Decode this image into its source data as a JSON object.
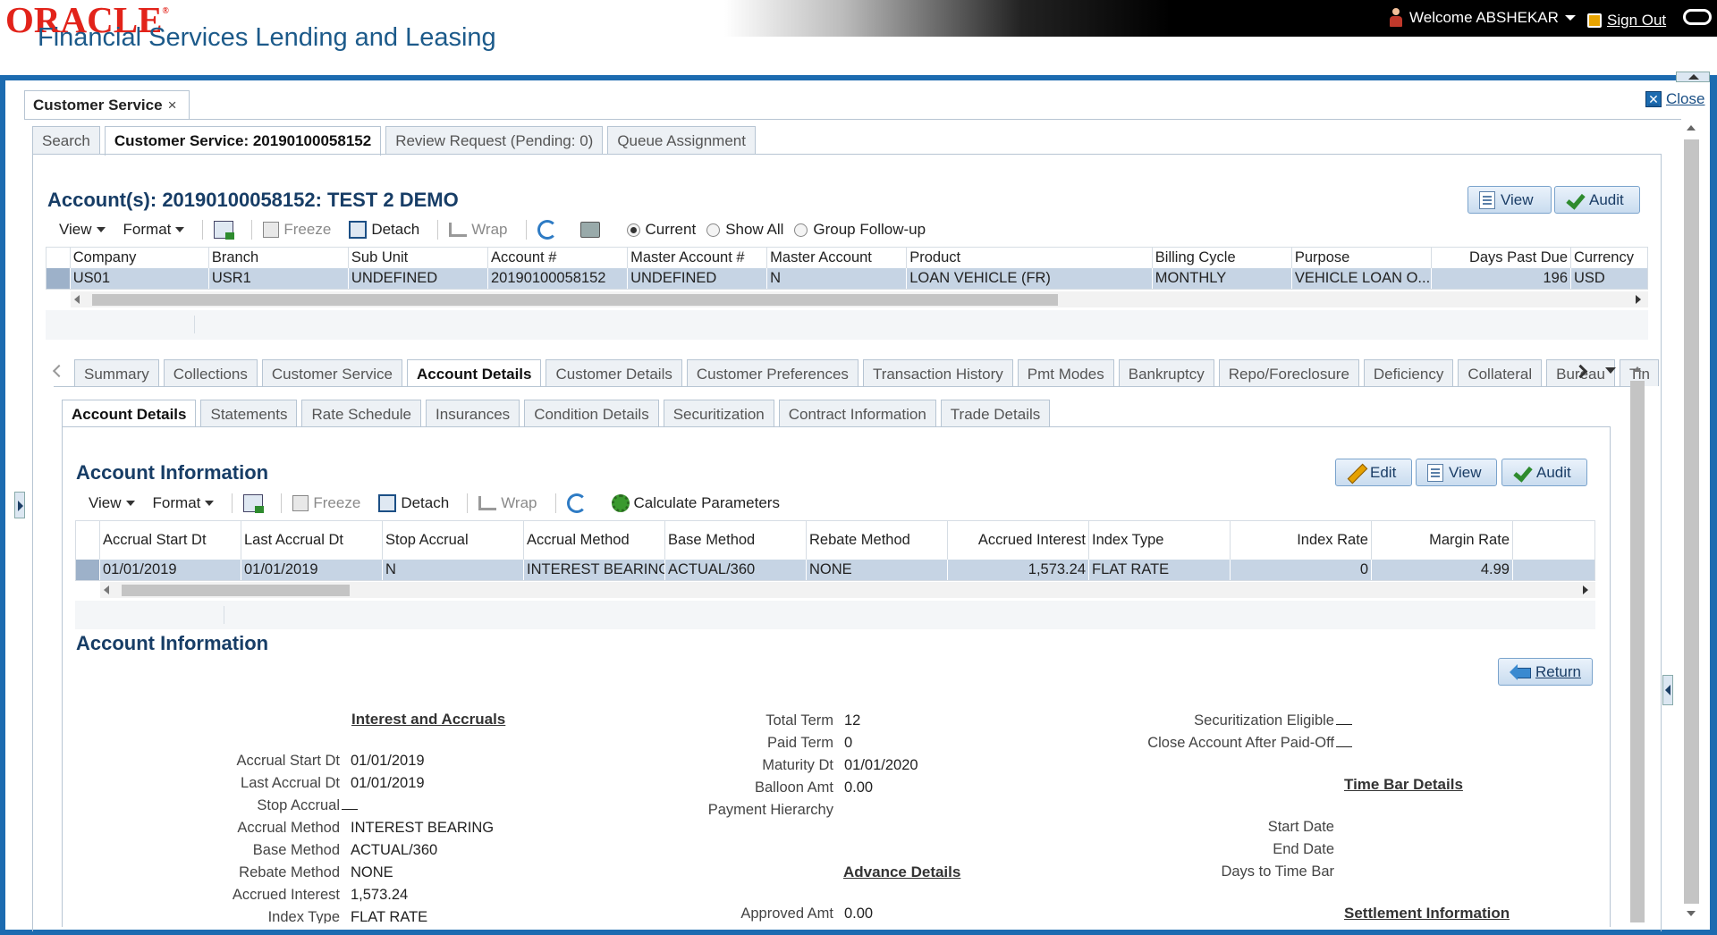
{
  "header": {
    "brand": "ORACLE",
    "product": "Financial Services Lending and Leasing",
    "welcome": "Welcome ABSHEKAR",
    "signout": "Sign Out"
  },
  "window": {
    "tab_title": "Customer Service",
    "close_label": "Close"
  },
  "top_tabs": [
    "Search",
    "Customer Service: 20190100058152",
    "Review Request (Pending: 0)",
    "Queue Assignment"
  ],
  "accounts": {
    "title": "Account(s): 20190100058152: TEST 2 DEMO",
    "buttons": {
      "view": "View",
      "audit": "Audit"
    },
    "toolbar": {
      "view": "View",
      "format": "Format",
      "freeze": "Freeze",
      "detach": "Detach",
      "wrap": "Wrap"
    },
    "radios": {
      "current": "Current",
      "show_all": "Show All",
      "group_follow_up": "Group Follow-up",
      "selected": "current"
    },
    "columns": [
      "Company",
      "Branch",
      "Sub Unit",
      "Account #",
      "Master Account #",
      "Master Account",
      "Product",
      "Billing Cycle",
      "Purpose",
      "Days Past Due",
      "Currency"
    ],
    "row": [
      "US01",
      "USR1",
      "UNDEFINED",
      "20190100058152",
      "UNDEFINED",
      "N",
      "LOAN VEHICLE (FR)",
      "MONTHLY",
      "VEHICLE LOAN O...",
      "196",
      "USD"
    ]
  },
  "section_tabs": [
    "Summary",
    "Collections",
    "Customer Service",
    "Account Details",
    "Customer Details",
    "Customer Preferences",
    "Transaction History",
    "Pmt Modes",
    "Bankruptcy",
    "Repo/Foreclosure",
    "Deficiency",
    "Collateral",
    "Bureau",
    "Tin"
  ],
  "detail_tabs": [
    "Account Details",
    "Statements",
    "Rate Schedule",
    "Insurances",
    "Condition Details",
    "Securitization",
    "Contract Information",
    "Trade Details"
  ],
  "account_info": {
    "title": "Account Information",
    "buttons": {
      "edit": "Edit",
      "view": "View",
      "audit": "Audit"
    },
    "toolbar": {
      "view": "View",
      "format": "Format",
      "freeze": "Freeze",
      "detach": "Detach",
      "wrap": "Wrap",
      "calculate": "Calculate Parameters"
    },
    "columns": [
      "Accrual Start Dt",
      "Last Accrual Dt",
      "Stop Accrual",
      "Accrual Method",
      "Base Method",
      "Rebate Method",
      "Accrued Interest",
      "Index Type",
      "Index Rate",
      "Margin Rate"
    ],
    "row": [
      "01/01/2019",
      "01/01/2019",
      "N",
      "INTEREST BEARING",
      "ACTUAL/360",
      "NONE",
      "1,573.24",
      "FLAT RATE",
      "0",
      "4.99"
    ]
  },
  "detail": {
    "title": "Account Information",
    "return_label": "Return",
    "interest_heading": "Interest and Accruals",
    "interest": [
      {
        "label": "Accrual Start Dt",
        "value": "01/01/2019"
      },
      {
        "label": "Last Accrual Dt",
        "value": "01/01/2019"
      },
      {
        "label": "Stop Accrual",
        "value": ""
      },
      {
        "label": "Accrual Method",
        "value": "INTEREST BEARING"
      },
      {
        "label": "Base Method",
        "value": "ACTUAL/360"
      },
      {
        "label": "Rebate Method",
        "value": "NONE"
      },
      {
        "label": "Accrued Interest",
        "value": "1,573.24"
      },
      {
        "label": "Index Type",
        "value": "FLAT RATE"
      }
    ],
    "term": [
      {
        "label": "Total Term",
        "value": "12"
      },
      {
        "label": "Paid Term",
        "value": "0"
      },
      {
        "label": "Maturity Dt",
        "value": "01/01/2020"
      },
      {
        "label": "Balloon Amt",
        "value": "0.00"
      },
      {
        "label": "Payment Hierarchy",
        "value": ""
      }
    ],
    "advance_heading": "Advance Details",
    "advance": [
      {
        "label": "Approved Amt",
        "value": "0.00"
      }
    ],
    "securitization": [
      {
        "label": "Securitization Eligible",
        "value": ""
      },
      {
        "label": "Close Account After Paid-Off",
        "value": ""
      }
    ],
    "timebar_heading": "Time Bar Details",
    "timebar": [
      {
        "label": "Start Date",
        "value": ""
      },
      {
        "label": "End Date",
        "value": ""
      },
      {
        "label": "Days to Time Bar",
        "value": ""
      }
    ],
    "settlement_heading": "Settlement Information"
  }
}
